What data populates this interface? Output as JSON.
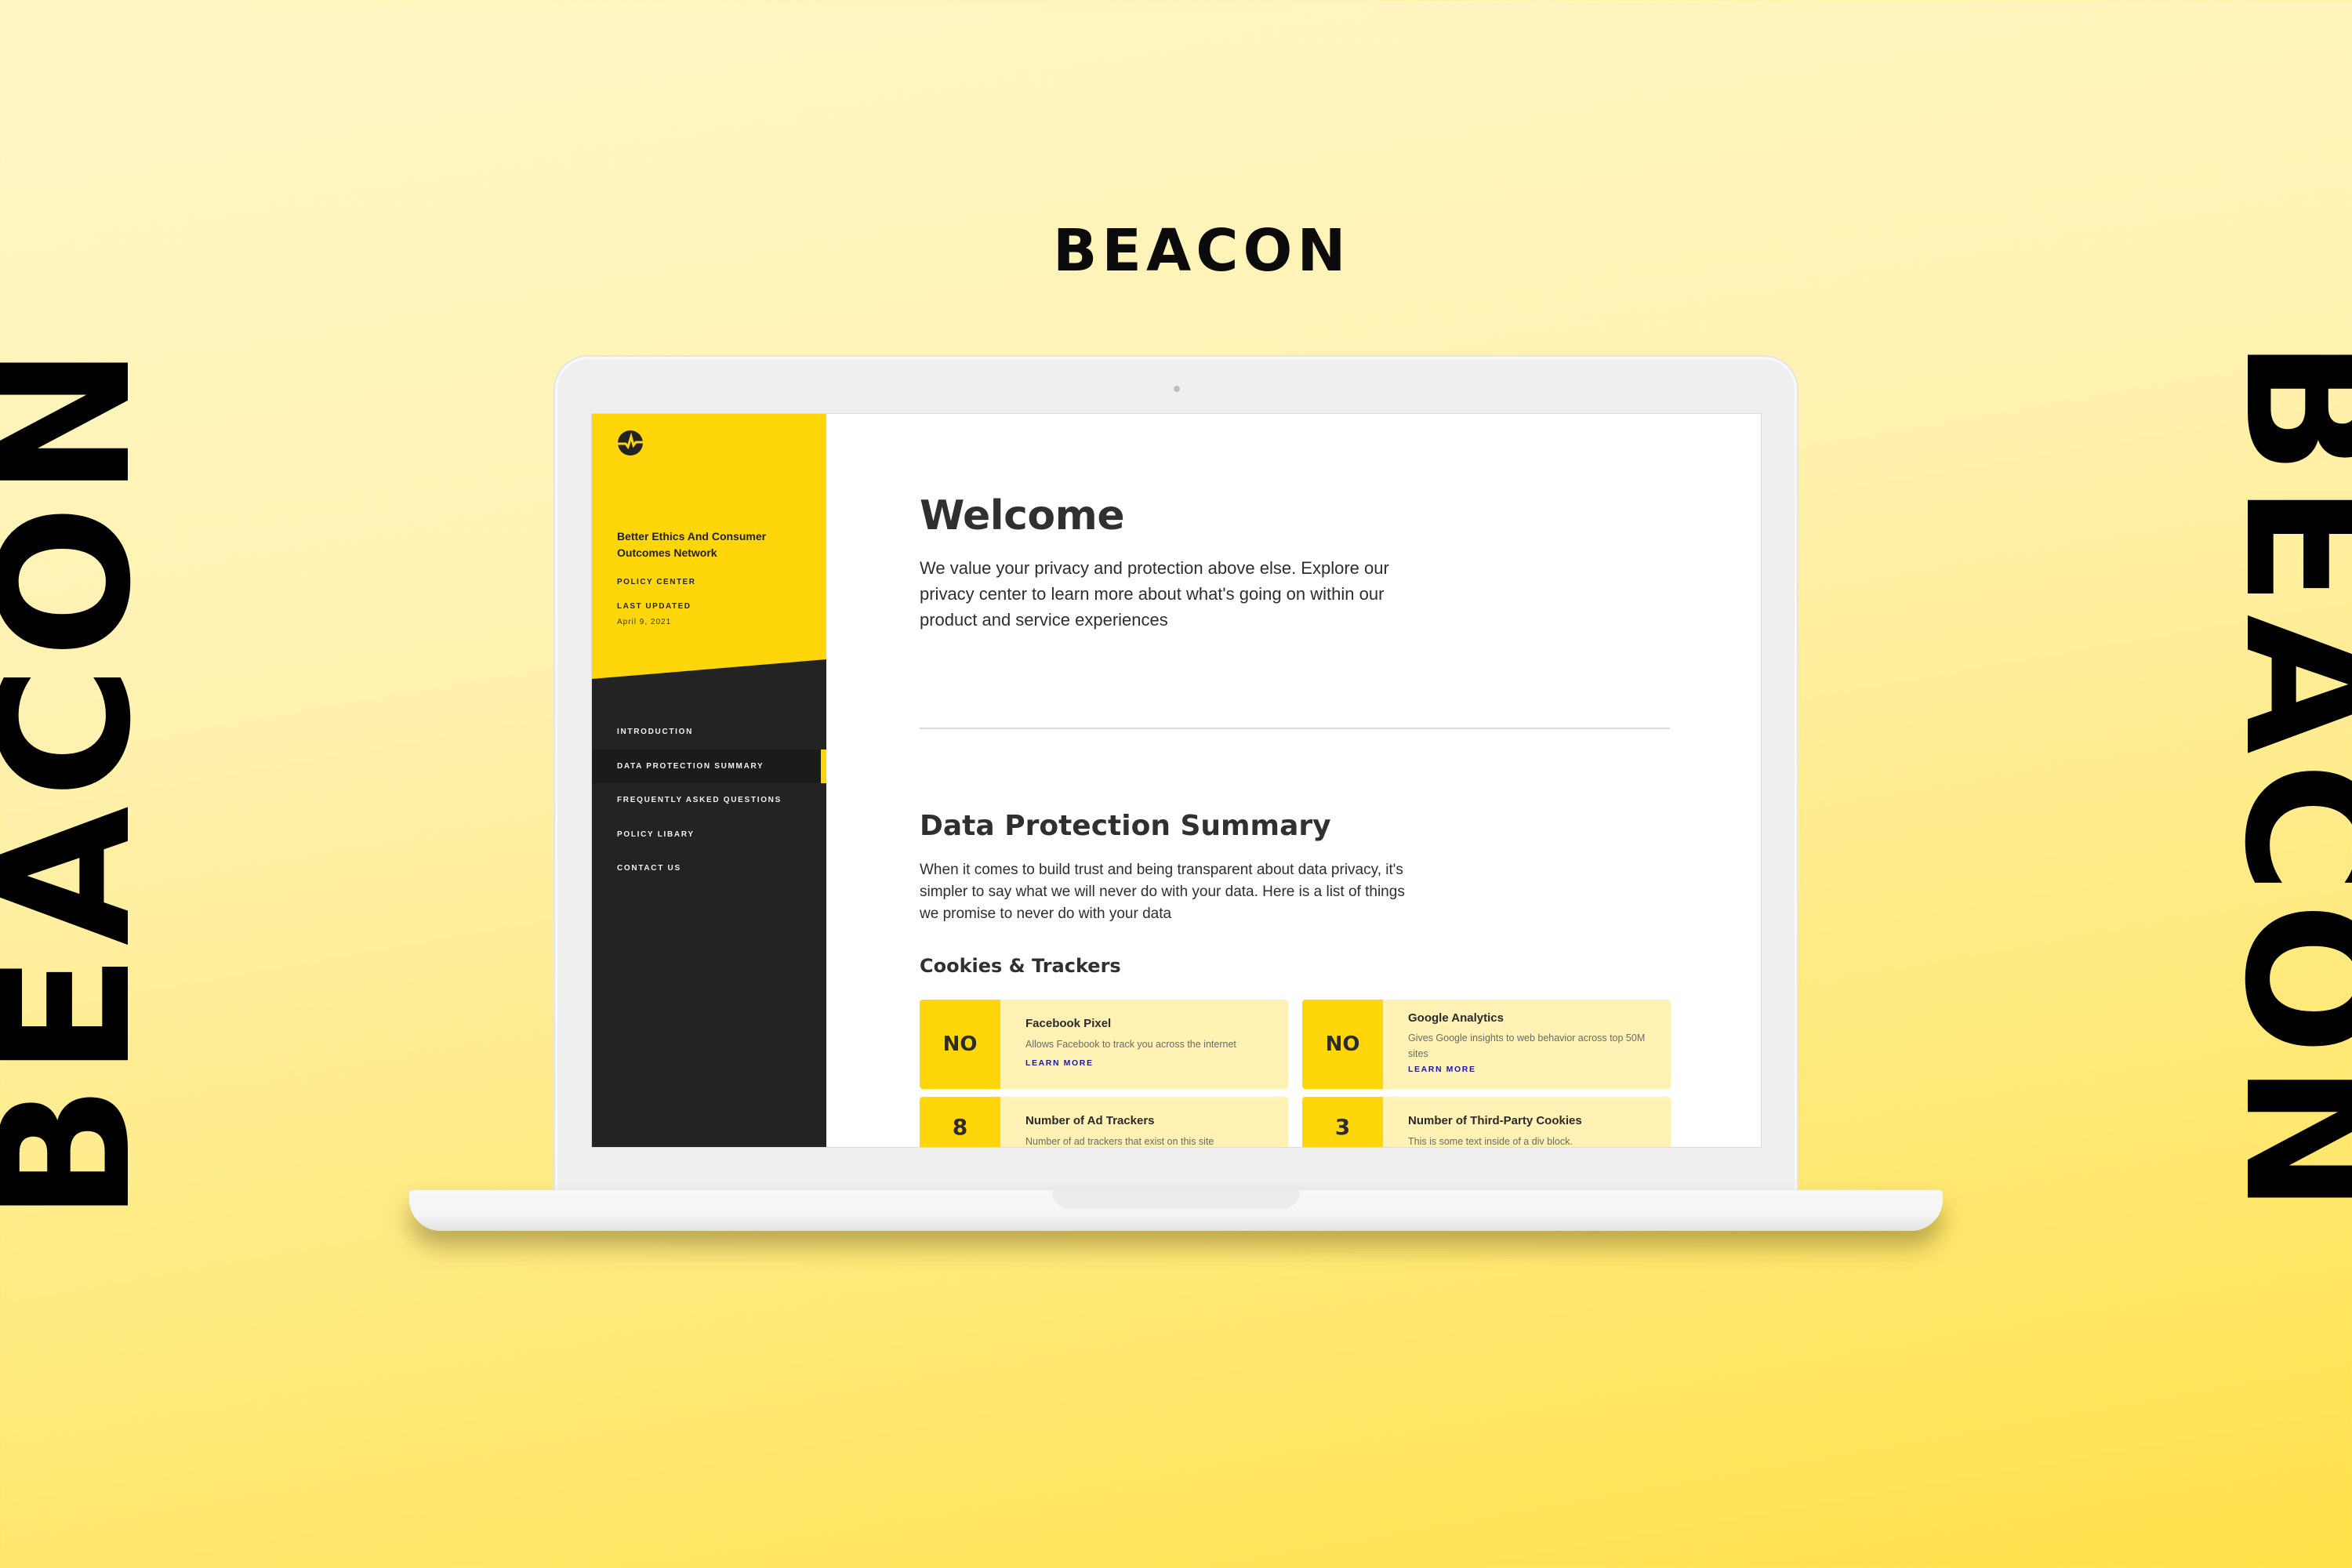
{
  "branding": {
    "wordmark": "BEACON",
    "side_left": "BEACON",
    "side_right": "BEACON"
  },
  "colors": {
    "accent_yellow": "#ffd60a",
    "sidebar_dark": "#232323",
    "card_bg": "#fff2b4",
    "link_blue": "#1a15b8"
  },
  "sidebar": {
    "logo_icon": "pulse-circle-icon",
    "org_name": "Better Ethics And Consumer Outcomes Network",
    "section_label": "POLICY CENTER",
    "last_updated_label": "LAST UPDATED",
    "last_updated_date": "April 9, 2021",
    "nav": [
      {
        "label": "INTRODUCTION",
        "active": false
      },
      {
        "label": "DATA PROTECTION SUMMARY",
        "active": true
      },
      {
        "label": "FREQUENTLY ASKED QUESTIONS",
        "active": false
      },
      {
        "label": "POLICY LIBARY",
        "active": false
      },
      {
        "label": "CONTACT US",
        "active": false
      }
    ]
  },
  "main": {
    "welcome": {
      "title": "Welcome",
      "body": "We value your privacy and protection above else. Explore our privacy center to learn more about what's going on within our product and service experiences"
    },
    "data_protection": {
      "title": "Data Protection Summary",
      "body": "When it comes to build trust and being transparent about data privacy, it's simpler to say what we will never do with your data. Here is a list of things we promise to never do with your data"
    },
    "cookies_trackers": {
      "title": "Cookies & Trackers",
      "cards": [
        {
          "badge": "NO",
          "title": "Facebook Pixel",
          "description": "Allows Facebook to track you across the internet",
          "link": "LEARN MORE"
        },
        {
          "badge": "NO",
          "title": "Google Analytics",
          "description": "Gives Google insights to web behavior across top 50M sites",
          "link": "LEARN MORE"
        },
        {
          "badge": "8",
          "title": "Number of Ad Trackers",
          "description": "Number of ad trackers that exist on this site"
        },
        {
          "badge": "3",
          "title": "Number of Third-Party Cookies",
          "description": "This is some text inside of a div block."
        }
      ]
    }
  }
}
